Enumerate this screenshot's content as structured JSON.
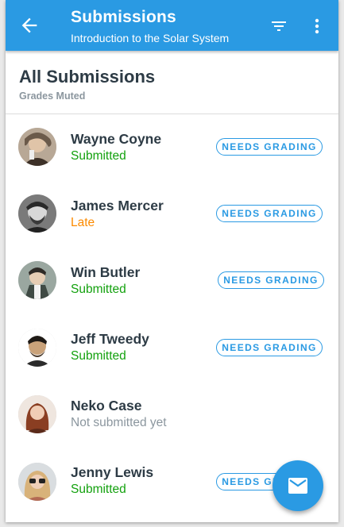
{
  "appbar": {
    "title": "Submissions",
    "subtitle": "Introduction to the Solar System",
    "color": "#2a9ae3"
  },
  "header": {
    "title": "All Submissions",
    "subtitle": "Grades Muted"
  },
  "status_colors": {
    "submitted": "#13a10e",
    "late": "#fc8a00",
    "not_submitted": "#8b969e"
  },
  "submissions": [
    {
      "name": "Wayne Coyne",
      "status": "Submitted",
      "badge": "NEEDS GRADING"
    },
    {
      "name": "James Mercer",
      "status": "Late",
      "badge": "NEEDS GRADING"
    },
    {
      "name": "Win Butler",
      "status": "Submitted",
      "badge": "NEEDS GRADING"
    },
    {
      "name": "Jeff Tweedy",
      "status": "Submitted",
      "badge": "NEEDS GRADING"
    },
    {
      "name": "Neko Case",
      "status": "Not submitted yet",
      "badge": ""
    },
    {
      "name": "Jenny Lewis",
      "status": "Submitted",
      "badge": "NEEDS GRADING"
    }
  ],
  "icons": {
    "back": "arrow-back-icon",
    "filter": "filter-icon",
    "more": "more-vert-icon",
    "fab": "mail-icon"
  }
}
